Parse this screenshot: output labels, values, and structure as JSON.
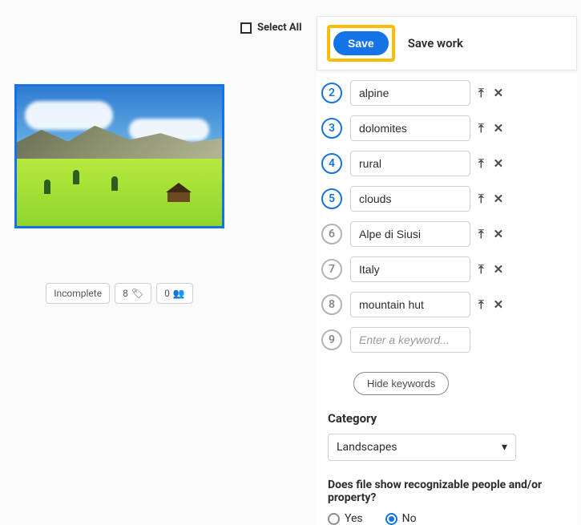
{
  "select_all_label": "Select All",
  "save_button_label": "Save",
  "save_work_label": "Save work",
  "status": {
    "incomplete_label": "Incomplete",
    "keyword_count": "8",
    "release_count": "0"
  },
  "keywords": [
    {
      "num": "2",
      "value": "alpine",
      "active": true
    },
    {
      "num": "3",
      "value": "dolomites",
      "active": true
    },
    {
      "num": "4",
      "value": "rural",
      "active": true
    },
    {
      "num": "5",
      "value": "clouds",
      "active": true
    },
    {
      "num": "6",
      "value": "Alpe di Siusi",
      "active": false
    },
    {
      "num": "7",
      "value": "Italy",
      "active": false
    },
    {
      "num": "8",
      "value": "mountain hut",
      "active": false
    }
  ],
  "keyword_placeholder_num": "9",
  "keyword_placeholder": "Enter a keyword...",
  "hide_keywords_label": "Hide keywords",
  "category_heading": "Category",
  "category_selected": "Landscapes",
  "question_label": "Does file show recognizable people and/or property?",
  "radio_yes_label": "Yes",
  "radio_no_label": "No"
}
